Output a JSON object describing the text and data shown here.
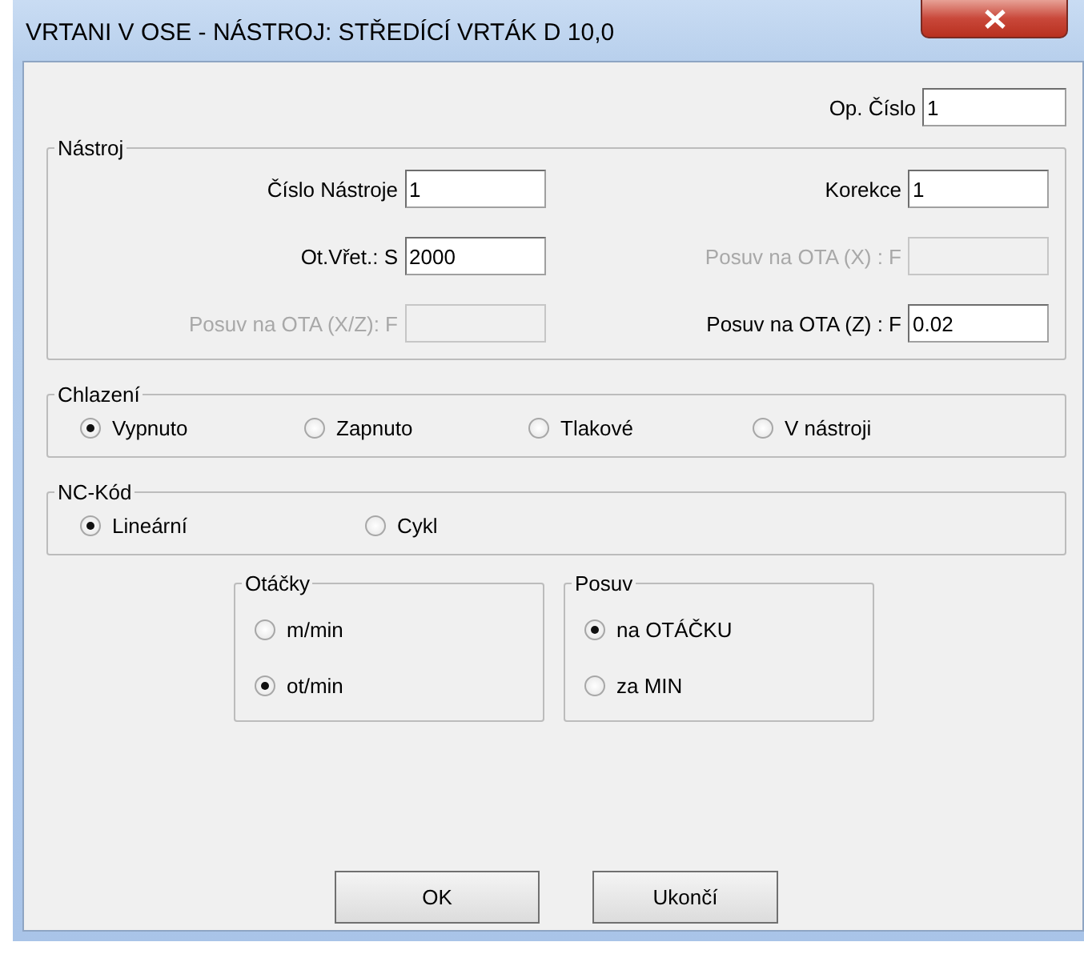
{
  "window": {
    "title": "VRTANI V OSE - NÁSTROJ: STŘEDÍCÍ VRTÁK D 10,0"
  },
  "op_cislo": {
    "label": "Op. Číslo",
    "value": "1"
  },
  "nastroj": {
    "title": "Nástroj",
    "fields": [
      {
        "label": "Číslo Nástroje",
        "value": "1",
        "disabled": false
      },
      {
        "label": "Korekce",
        "value": "1",
        "disabled": false
      },
      {
        "label": "Ot.Vřet.: S",
        "value": "2000",
        "disabled": false
      },
      {
        "label": "Posuv na OTA (X) : F",
        "disabled": true
      },
      {
        "label": "Posuv na OTA (X/Z): F",
        "disabled": true
      },
      {
        "label": "Posuv na OTA (Z) : F",
        "value": "0.02",
        "disabled": false
      }
    ]
  },
  "chlazeni": {
    "title": "Chlazení",
    "options": [
      {
        "label": "Vypnuto",
        "selected": true
      },
      {
        "label": "Zapnuto",
        "selected": false
      },
      {
        "label": "Tlakové",
        "selected": false
      },
      {
        "label": "V nástroji",
        "selected": false
      }
    ]
  },
  "nc_kod": {
    "title": "NC-Kód",
    "options": [
      {
        "label": "Lineární",
        "selected": true
      },
      {
        "label": "Cykl",
        "selected": false
      }
    ]
  },
  "otacky": {
    "title": "Otáčky",
    "options": [
      {
        "label": "m/min",
        "selected": false
      },
      {
        "label": "ot/min",
        "selected": true
      }
    ]
  },
  "posuv": {
    "title": "Posuv",
    "options": [
      {
        "label": "na OTÁČKU",
        "selected": true
      },
      {
        "label": "za MIN",
        "selected": false
      }
    ]
  },
  "buttons": [
    "OK",
    "Ukončí"
  ]
}
